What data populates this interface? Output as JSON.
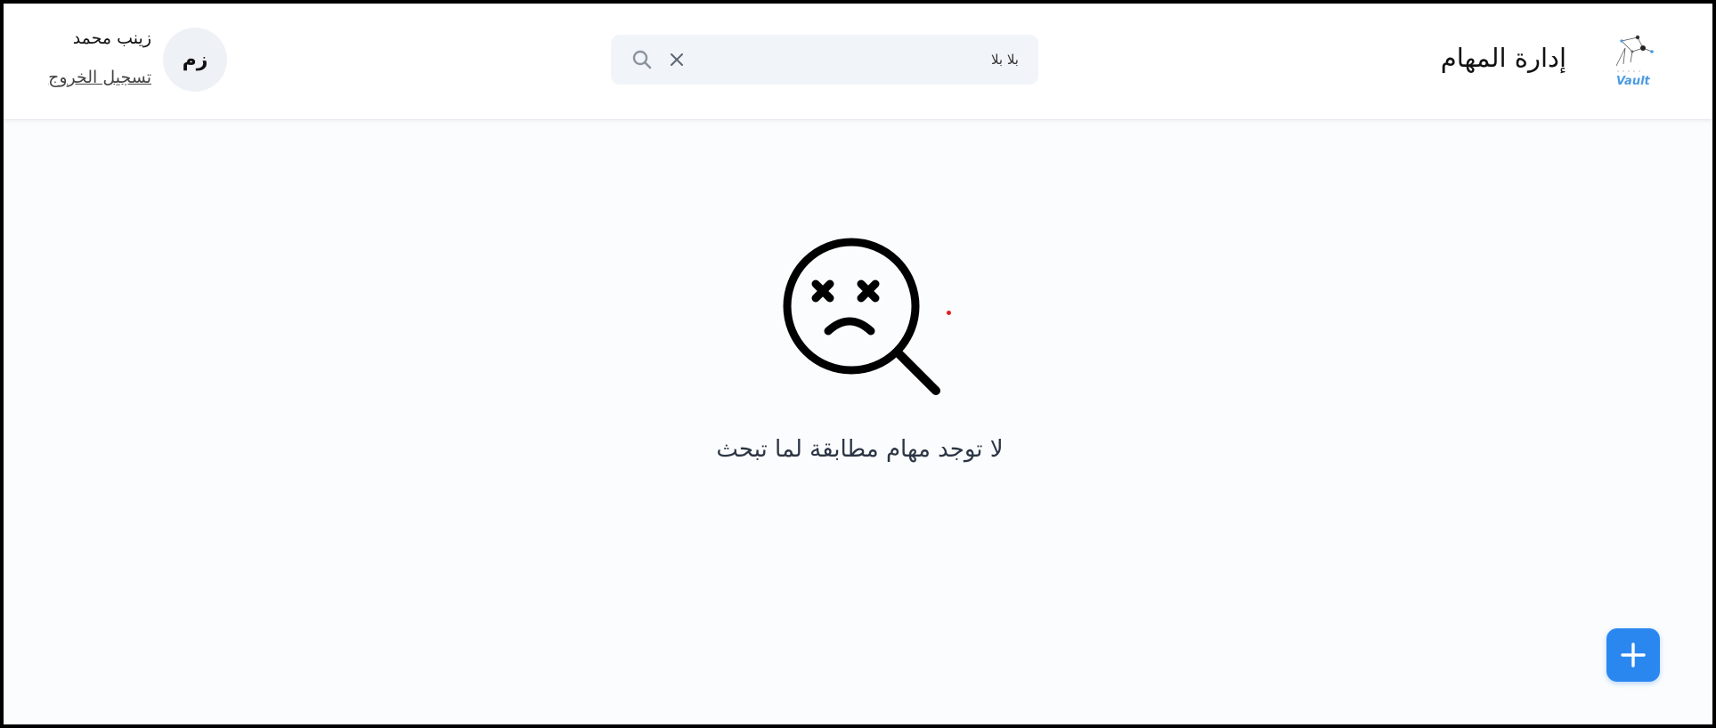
{
  "header": {
    "title": "إدارة المهام",
    "logo": {
      "text": "Vault",
      "icon": "constellation-logo-icon",
      "color": "#4a9be0"
    }
  },
  "search": {
    "value": "بلا بلا",
    "placeholder": "",
    "clear_icon": "close-icon",
    "search_icon": "search-icon"
  },
  "user": {
    "initials": "زم",
    "name": "زينب محمد",
    "logout_label": "تسجيل الخروج"
  },
  "empty_state": {
    "icon": "sad-magnifier-icon",
    "message": "لا توجد مهام مطابقة لما تبحث"
  },
  "fab": {
    "icon": "plus-icon",
    "color": "#2b87f0"
  }
}
